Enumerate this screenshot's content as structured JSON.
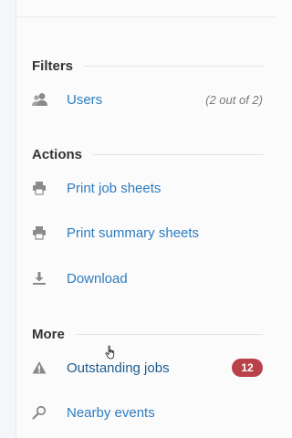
{
  "filters": {
    "title": "Filters",
    "items": [
      {
        "label": "Users",
        "meta": "(2 out of 2)",
        "icon": "users-icon"
      }
    ]
  },
  "actions": {
    "title": "Actions",
    "items": [
      {
        "label": "Print job sheets",
        "icon": "printer-icon"
      },
      {
        "label": "Print summary sheets",
        "icon": "printer-icon"
      },
      {
        "label": "Download",
        "icon": "download-icon"
      }
    ]
  },
  "more": {
    "title": "More",
    "items": [
      {
        "label": "Outstanding jobs",
        "badge": "12",
        "icon": "warning-icon"
      },
      {
        "label": "Nearby events",
        "icon": "search-icon"
      }
    ]
  },
  "colors": {
    "link": "#2e7cbf",
    "badge": "#b9414a",
    "heading": "#333333"
  }
}
